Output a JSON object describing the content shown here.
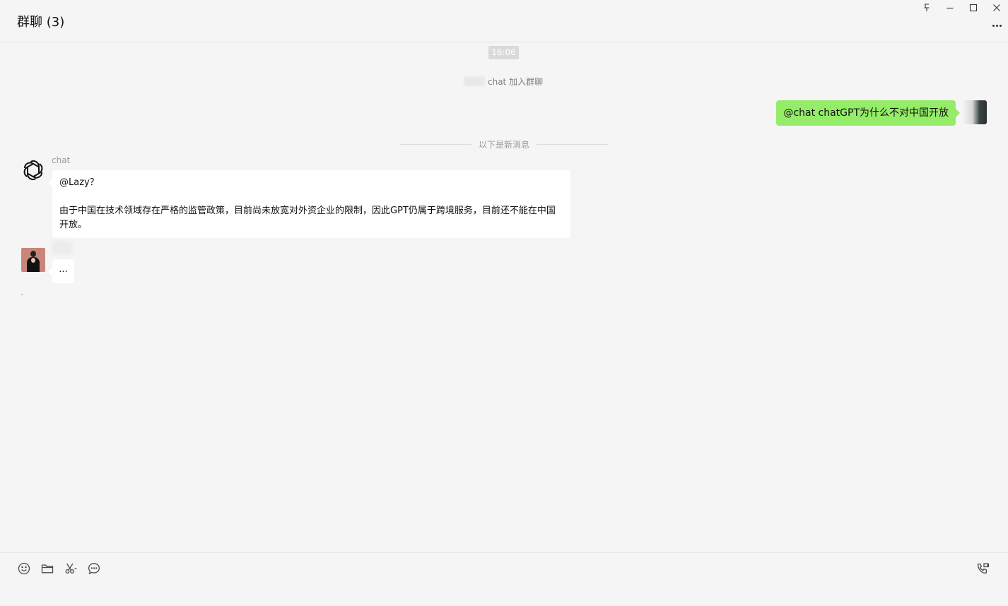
{
  "window": {
    "title": "群聊 (3)",
    "controls": [
      "pin-icon",
      "minimize-icon",
      "maximize-icon",
      "close-icon"
    ],
    "more": "more-icon"
  },
  "chat": {
    "timestamp": "16:06",
    "system_join": "chat 加入群聊",
    "outgoing": {
      "text": "@chat chatGPT为什么不对中国开放",
      "bubble_color": "#95ec69"
    },
    "divider": "以下是新消息",
    "reply": {
      "sender": "chat",
      "avatar": "openai-logo-icon",
      "line1": "@Lazy？",
      "line2": "由于中国在技术领域存在严格的监管政策，目前尚未放宽对外资企业的限制，因此GPT仍属于跨境服务，目前还不能在中国开放。"
    },
    "typing": {
      "text": "..."
    }
  },
  "toolbar": {
    "items": [
      "emoji-icon",
      "folder-icon",
      "scissors-icon",
      "chat-history-icon"
    ],
    "call": "voice-video-call-icon"
  },
  "colors": {
    "background": "#f5f5f5",
    "accent_green": "#95ec69"
  }
}
